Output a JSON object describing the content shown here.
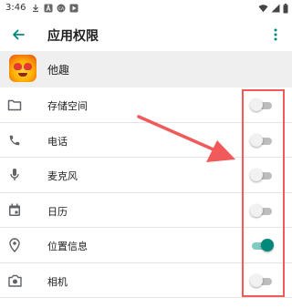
{
  "status_bar": {
    "time": "3:46",
    "left_icons": [
      "download-icon",
      "a-icon",
      "ca-icon",
      "play-store-icon"
    ],
    "right_icons": [
      "wifi-icon",
      "signal-icon",
      "battery-icon"
    ]
  },
  "app_bar": {
    "title": "应用权限",
    "back_icon": "arrow-back-icon",
    "more_icon": "more-vert-icon",
    "accent_color": "#00897b"
  },
  "app": {
    "name": "他趣"
  },
  "permissions": [
    {
      "icon": "folder-icon",
      "label": "存储空间",
      "enabled": false
    },
    {
      "icon": "phone-icon",
      "label": "电话",
      "enabled": false
    },
    {
      "icon": "mic-icon",
      "label": "麦克风",
      "enabled": false
    },
    {
      "icon": "calendar-icon",
      "label": "日历",
      "enabled": false
    },
    {
      "icon": "location-icon",
      "label": "位置信息",
      "enabled": true
    },
    {
      "icon": "camera-icon",
      "label": "相机",
      "enabled": false
    }
  ],
  "annotation": {
    "color": "#f05a5a"
  }
}
